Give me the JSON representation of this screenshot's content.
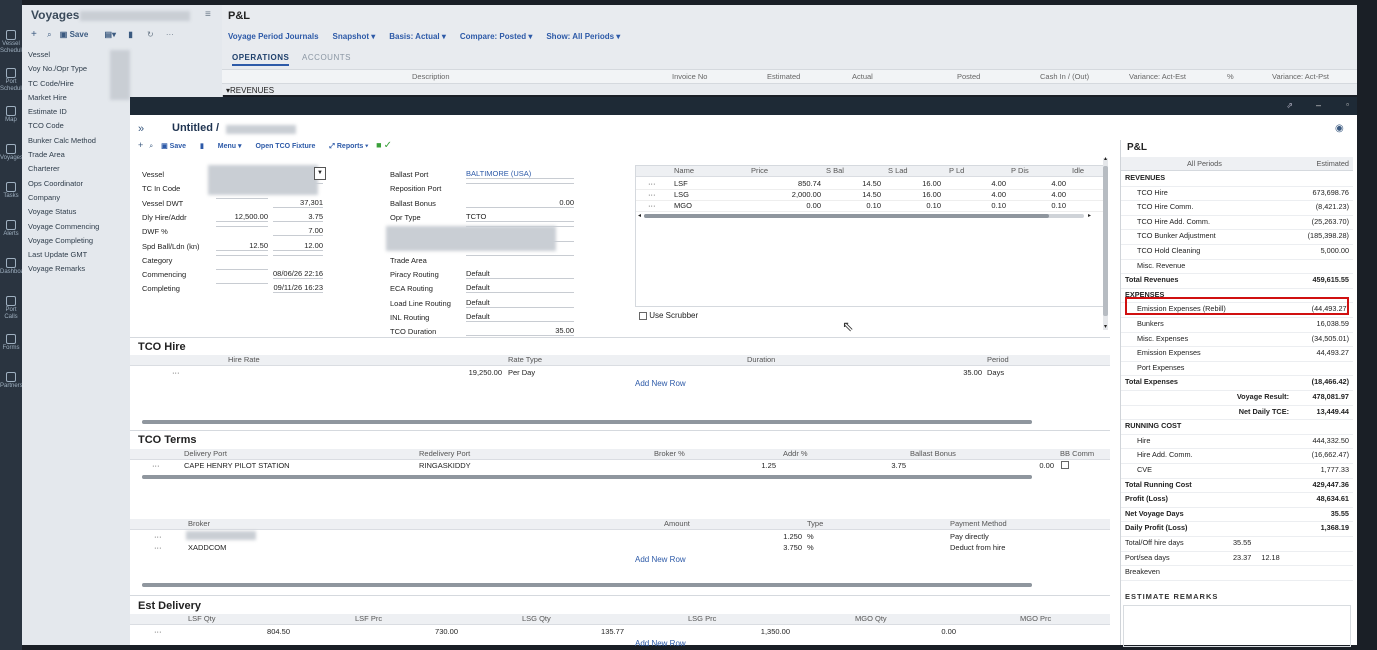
{
  "rail": {
    "items": [
      "Vessel Schedule",
      "Port Schedule",
      "Map",
      "Voyages",
      "Tasks",
      "Alerts",
      "Dashboard",
      "Port Calls",
      "Forms",
      "Partners"
    ]
  },
  "voyages": {
    "title": "Voyages",
    "save_label": "Save",
    "fields": [
      "Vessel",
      "Voy No./Opr Type",
      "TC Code/Hire",
      "Market Hire",
      "Estimate ID",
      "TCO Code",
      "Bunker Calc Method",
      "Trade Area",
      "Charterer",
      "Ops Coordinator",
      "Company",
      "Voyage Status",
      "Voyage Commencing",
      "Voyage Completing",
      "Last Update GMT",
      "Voyage Remarks"
    ]
  },
  "pl_bg": {
    "title": "P&L",
    "toolbar": [
      "Voyage Period Journals",
      "Snapshot ▾",
      "Basis: Actual ▾",
      "Compare: Posted ▾",
      "Show: All Periods ▾"
    ],
    "tabs": [
      "OPERATIONS",
      "ACCOUNTS"
    ],
    "columns": [
      "Description",
      "Invoice No",
      "Estimated",
      "Actual",
      "Posted",
      "Cash In / (Out)",
      "Variance: Act-Est",
      "%",
      "Variance: Act-Pst"
    ],
    "first_row": "▾REVENUES"
  },
  "modal": {
    "title": "Untitled /",
    "toolbar": {
      "save": "Save",
      "menu": "Menu ▾",
      "open_tco": "Open TCO Fixture",
      "reports": "Reports ▾"
    },
    "left_fields": [
      {
        "label": "Vessel",
        "v1": "",
        "v2": ""
      },
      {
        "label": "TC In Code",
        "v1": "",
        "v2": ""
      },
      {
        "label": "Vessel DWT",
        "v1": "",
        "v2": "37,301"
      },
      {
        "label": "Dly Hire/Addr",
        "v1": "12,500.00",
        "v2": "3.75"
      },
      {
        "label": "DWF %",
        "v1": "",
        "v2": "7.00"
      },
      {
        "label": "Spd Ball/Ldn (kn)",
        "v1": "12.50",
        "v2": "12.00"
      },
      {
        "label": "Category",
        "v1": "",
        "v2": ""
      },
      {
        "label": "Commencing",
        "v1": "",
        "v2": "08/06/26 22:16"
      },
      {
        "label": "Completing",
        "v1": "",
        "v2": "09/11/26 16:23"
      }
    ],
    "mid_fields": [
      {
        "label": "Ballast Port",
        "value": "BALTIMORE (USA)"
      },
      {
        "label": "Reposition Port",
        "value": ""
      },
      {
        "label": "Ballast Bonus",
        "value": "0.00"
      },
      {
        "label": "Opr Type",
        "value": "TCTO"
      },
      {
        "label": "",
        "value": ""
      },
      {
        "label": "",
        "value": ""
      },
      {
        "label": "Trade Area",
        "value": ""
      },
      {
        "label": "Piracy Routing",
        "value": "Default"
      },
      {
        "label": "ECA Routing",
        "value": "Default"
      },
      {
        "label": "Load Line Routing",
        "value": "Default"
      },
      {
        "label": "INL Routing",
        "value": "Default"
      },
      {
        "label": "TCO Duration",
        "value": "35.00"
      }
    ],
    "bunker_cols": [
      "Name",
      "Price",
      "S Bal",
      "S Lad",
      "P Ld",
      "P Dis",
      "Idle"
    ],
    "bunker_rows": [
      [
        "LSF",
        "850.74",
        "14.50",
        "16.00",
        "4.00",
        "4.00"
      ],
      [
        "LSG",
        "2,000.00",
        "14.50",
        "16.00",
        "4.00",
        "4.00"
      ],
      [
        "MGO",
        "0.00",
        "0.10",
        "0.10",
        "0.10",
        "0.10"
      ]
    ],
    "use_scrubber": "Use Scrubber",
    "tco_hire": {
      "title": "TCO Hire",
      "cols": [
        "Hire Rate",
        "Rate Type",
        "Duration",
        "Period"
      ],
      "row": {
        "rate": "19,250.00",
        "type": "Per Day",
        "period_val": "35.00",
        "period_unit": "Days"
      },
      "add": "Add New Row"
    },
    "tco_terms": {
      "title": "TCO Terms",
      "cols": [
        "Delivery Port",
        "Redelivery Port",
        "Broker %",
        "Addr %",
        "Ballast Bonus",
        "BB Comm"
      ],
      "row": {
        "delivery": "CAPE HENRY PILOT STATION",
        "redelivery": "RINGASKIDDY",
        "addr": "1.25",
        "bonus": "3.75",
        "bb": "0.00"
      }
    },
    "brokers": {
      "cols": [
        "Broker",
        "Amount",
        "Type",
        "Payment Method"
      ],
      "rows": [
        {
          "name": "",
          "amount": "1.250",
          "type": "%",
          "method": "Pay directly"
        },
        {
          "name": "XADDCOM",
          "amount": "3.750",
          "type": "%",
          "method": "Deduct from hire"
        }
      ],
      "add": "Add New Row"
    },
    "est_delivery": {
      "title": "Est Delivery",
      "cols": [
        "LSF Qty",
        "LSF Prc",
        "LSG Qty",
        "LSG Prc",
        "MGO Qty",
        "MGO Prc"
      ],
      "row": [
        "804.50",
        "730.00",
        "135.77",
        "1,350.00",
        "0.00",
        ""
      ],
      "add": "Add New Row"
    }
  },
  "pl_side": {
    "title": "P&L",
    "col1": "All Periods",
    "col2": "Estimated",
    "rows": [
      {
        "label": "REVENUES",
        "value": "",
        "style": "b"
      },
      {
        "label": "TCO Hire",
        "value": "673,698.76",
        "style": "i"
      },
      {
        "label": "TCO Hire Comm.",
        "value": "(8,421.23)",
        "style": "i"
      },
      {
        "label": "TCO Hire Add. Comm.",
        "value": "(25,263.70)",
        "style": "i"
      },
      {
        "label": "TCO Bunker Adjustment",
        "value": "(185,398.28)",
        "style": "i"
      },
      {
        "label": "TCO Hold Cleaning",
        "value": "5,000.00",
        "style": "i"
      },
      {
        "label": "Misc. Revenue",
        "value": "",
        "style": "i"
      },
      {
        "label": "Total Revenues",
        "value": "459,615.55",
        "style": "b"
      },
      {
        "label": "EXPENSES",
        "value": "",
        "style": "b"
      },
      {
        "label": "Emission Expenses (Rebill)",
        "value": "(44,493.27)",
        "style": "i"
      },
      {
        "label": "Bunkers",
        "value": "16,038.59",
        "style": "i"
      },
      {
        "label": "Misc. Expenses",
        "value": "(34,505.01)",
        "style": "i"
      },
      {
        "label": "Emission Expenses",
        "value": "44,493.27",
        "style": "i"
      },
      {
        "label": "Port Expenses",
        "value": "",
        "style": "i"
      },
      {
        "label": "Total Expenses",
        "value": "(18,466.42)",
        "style": "b"
      },
      {
        "label": "Voyage Result:",
        "value": "478,081.97",
        "style": "rb"
      },
      {
        "label": "Net Daily TCE:",
        "value": "13,449.44",
        "style": "rb"
      },
      {
        "label": "RUNNING COST",
        "value": "",
        "style": "b"
      },
      {
        "label": "Hire",
        "value": "444,332.50",
        "style": "i"
      },
      {
        "label": "Hire Add. Comm.",
        "value": "(16,662.47)",
        "style": "i"
      },
      {
        "label": "CVE",
        "value": "1,777.33",
        "style": "i"
      },
      {
        "label": "Total Running Cost",
        "value": "429,447.36",
        "style": "b"
      },
      {
        "label": "Profit (Loss)",
        "value": "48,634.61",
        "style": "b"
      },
      {
        "label": "Net Voyage Days",
        "value": "35.55",
        "style": "b"
      },
      {
        "label": "Daily Profit (Loss)",
        "value": "1,368.19",
        "style": "b"
      },
      {
        "label": "Total/Off hire days",
        "value": "35.55",
        "style": "m"
      },
      {
        "label": "Port/sea days",
        "value": "23.37     12.18",
        "style": "n"
      },
      {
        "label": "Breakeven",
        "value": "",
        "style": "n"
      }
    ],
    "remarks": "ESTIMATE REMARKS"
  }
}
